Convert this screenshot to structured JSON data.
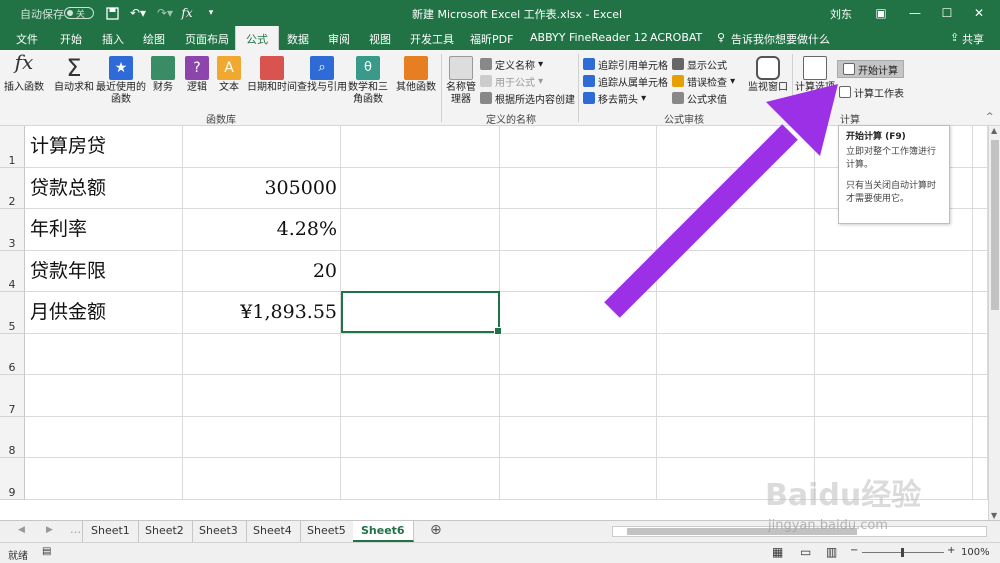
{
  "titlebar": {
    "autosave_label": "自动保存",
    "autosave_state": "关",
    "title": "新建 Microsoft Excel 工作表.xlsx  -  Excel",
    "user": "刘东"
  },
  "menu": {
    "tabs": [
      "文件",
      "开始",
      "插入",
      "绘图",
      "页面布局",
      "公式",
      "数据",
      "审阅",
      "视图",
      "开发工具",
      "福昕PDF",
      "ABBYY FineReader 12",
      "ACROBAT",
      "告诉我你想要做什么"
    ],
    "active_tab": "公式",
    "share": "共享"
  },
  "ribbon": {
    "insert_function": "插入函数",
    "autosum": "自动求和",
    "recent": "最近使用的函数",
    "finance": "财务",
    "logic": "逻辑",
    "text": "文本",
    "datetime": "日期和时间",
    "lookup": "查找与引用",
    "math": "数学和三角函数",
    "other": "其他函数",
    "group_library": "函数库",
    "name_manager": "名称管理器",
    "define_name": "定义名称",
    "use_in_formula": "用于公式",
    "create_from_selection": "根据所选内容创建",
    "group_names": "定义的名称",
    "trace_precedents": "追踪引用单元格",
    "trace_dependents": "追踪从属单元格",
    "remove_arrows": "移去箭头",
    "show_formulas": "显示公式",
    "error_checking": "错误检查",
    "evaluate_formula": "公式求值",
    "watch_window": "监视窗口",
    "group_audit": "公式审核",
    "calc_options": "计算选项",
    "calc_now": "开始计算",
    "calc_sheet": "计算工作表",
    "group_calc": "计算"
  },
  "tooltip": {
    "title": "开始计算 (F9)",
    "line1": "立即对整个工作簿进行计算。",
    "line2": "只有当关闭自动计算时才需要使用它。"
  },
  "rows": [
    {
      "num": "1",
      "label": "计算房贷",
      "value": ""
    },
    {
      "num": "2",
      "label": "贷款总额",
      "value": "305000"
    },
    {
      "num": "3",
      "label": "年利率",
      "value": "4.28%"
    },
    {
      "num": "4",
      "label": "贷款年限",
      "value": "20"
    },
    {
      "num": "5",
      "label": "月供金额",
      "value": "¥1,893.55"
    },
    {
      "num": "6",
      "label": "",
      "value": ""
    },
    {
      "num": "7",
      "label": "",
      "value": ""
    },
    {
      "num": "8",
      "label": "",
      "value": ""
    },
    {
      "num": "9",
      "label": "",
      "value": ""
    }
  ],
  "sheets": [
    "Sheet1",
    "Sheet2",
    "Sheet3",
    "Sheet4",
    "Sheet5",
    "Sheet6"
  ],
  "active_sheet": "Sheet6",
  "status": {
    "ready": "就绪",
    "zoom": "100%"
  },
  "watermark": {
    "brand": "Baidu经验",
    "url": "jingyan.baidu.com"
  },
  "colors": {
    "excel_green": "#217346",
    "arrow": "#9b30e6"
  }
}
